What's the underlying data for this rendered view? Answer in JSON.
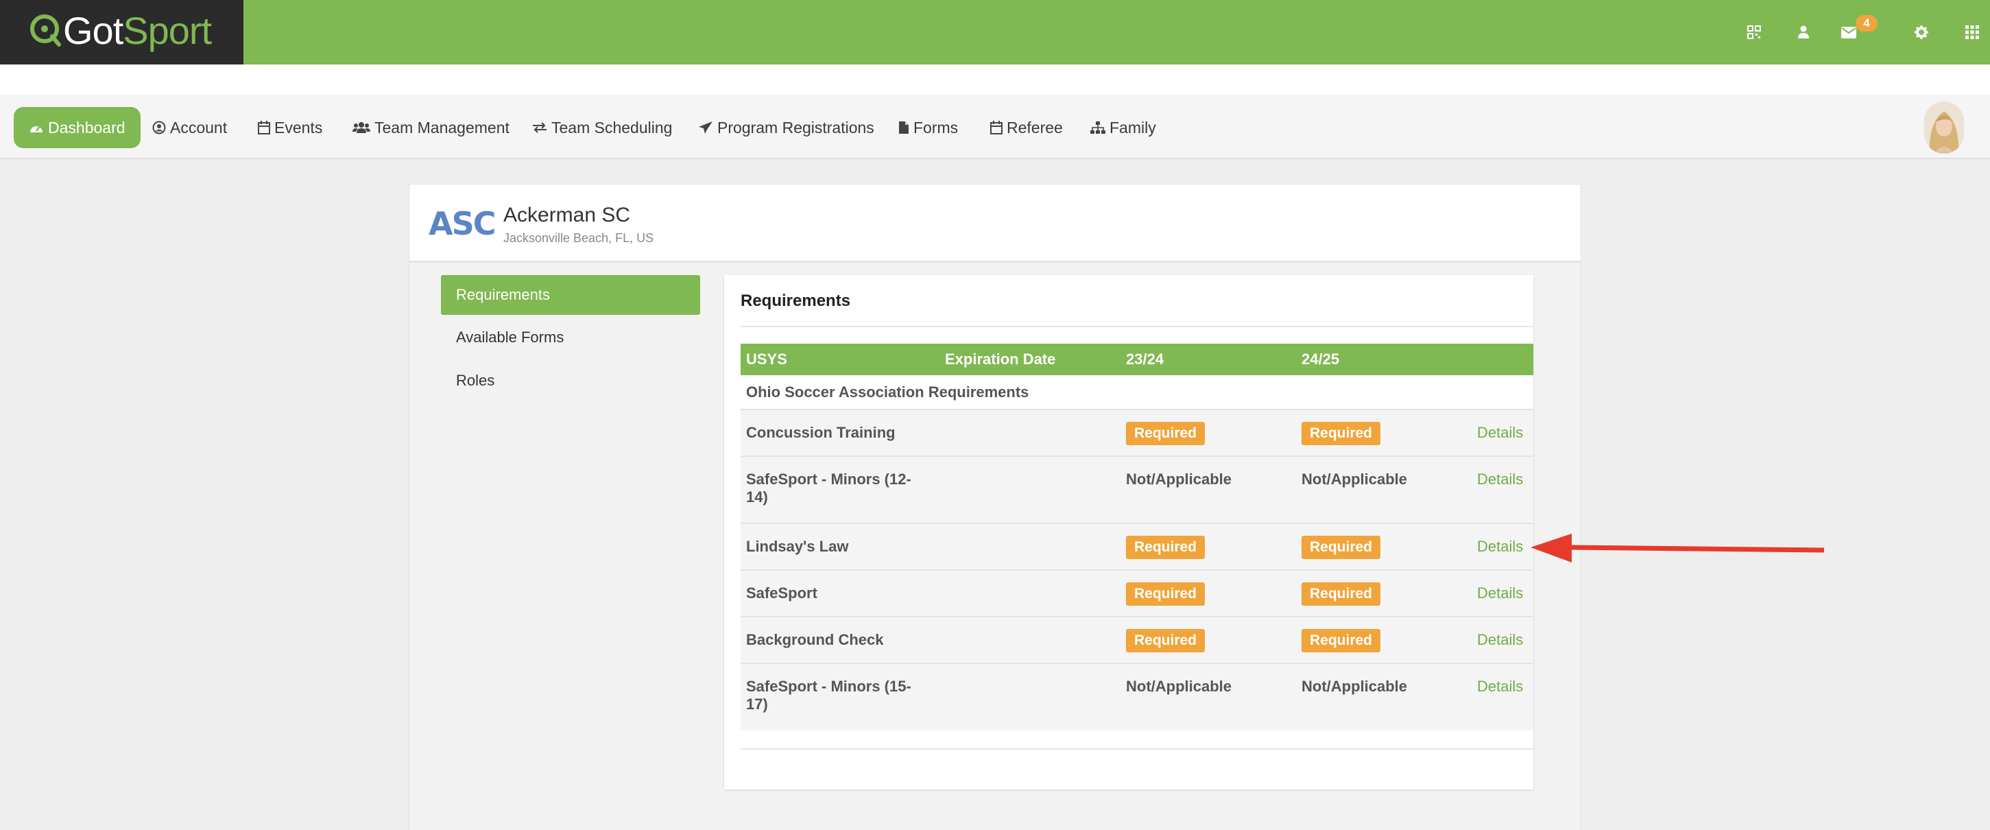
{
  "app": {
    "logo_got": "Got",
    "logo_sport": "Sport",
    "mail_count": "4"
  },
  "nav": {
    "items": [
      {
        "label": "Dashboard",
        "icon": "dashboard-icon"
      },
      {
        "label": "Account",
        "icon": "user-circle-icon"
      },
      {
        "label": "Events",
        "icon": "calendar-icon"
      },
      {
        "label": "Team Management",
        "icon": "users-icon"
      },
      {
        "label": "Team Scheduling",
        "icon": "exchange-icon"
      },
      {
        "label": "Program Registrations",
        "icon": "paper-plane-icon"
      },
      {
        "label": "Forms",
        "icon": "file-icon"
      },
      {
        "label": "Referee",
        "icon": "calendar-icon"
      },
      {
        "label": "Family",
        "icon": "sitemap-icon"
      }
    ]
  },
  "club": {
    "logo_text": "ASC",
    "name": "Ackerman SC",
    "location": "Jacksonville Beach, FL, US"
  },
  "sidebar": {
    "items": [
      {
        "label": "Requirements",
        "active": true
      },
      {
        "label": "Available Forms",
        "active": false
      },
      {
        "label": "Roles",
        "active": false
      }
    ]
  },
  "requirements": {
    "title": "Requirements",
    "columns": [
      "USYS",
      "Expiration Date",
      "23/24",
      "24/25",
      ""
    ],
    "group_label": "Ohio Soccer Association Requirements",
    "rows": [
      {
        "name": "Concussion Training",
        "expiration": "",
        "s2324": "Required",
        "s2425": "Required",
        "action": "Details"
      },
      {
        "name_line1": "SafeSport - Minors (12-",
        "name_line2": "14)",
        "expiration": "",
        "s2324": "Not/Applicable",
        "s2425": "Not/Applicable",
        "action": "Details"
      },
      {
        "name": "Lindsay's Law",
        "expiration": "",
        "s2324": "Required",
        "s2425": "Required",
        "action": "Details"
      },
      {
        "name": "SafeSport",
        "expiration": "",
        "s2324": "Required",
        "s2425": "Required",
        "action": "Details"
      },
      {
        "name": "Background Check",
        "expiration": "",
        "s2324": "Required",
        "s2425": "Required",
        "action": "Details"
      },
      {
        "name_line1": "SafeSport - Minors (15-",
        "name_line2": "17)",
        "expiration": "",
        "s2324": "Not/Applicable",
        "s2425": "Not/Applicable",
        "action": "Details"
      }
    ]
  },
  "colors": {
    "brand_green": "#80b852",
    "dark": "#2b2b2b",
    "required_orange": "#f0a43a",
    "link_green": "#70ad47",
    "annotation_red": "#e53a2c"
  }
}
